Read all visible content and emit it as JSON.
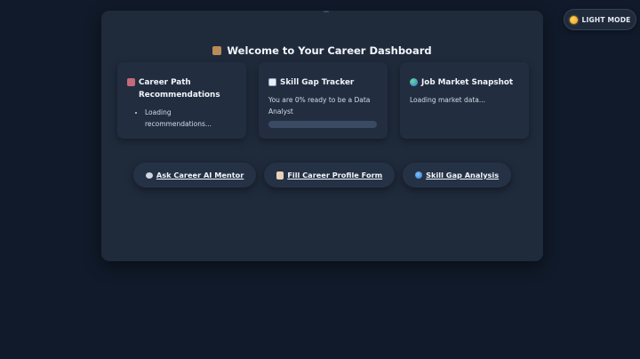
{
  "theme_toggle": {
    "label": "LIGHT MODE",
    "icon": "sun-icon"
  },
  "dashboard": {
    "title": "Welcome to Your Career Dashboard",
    "title_icon": "trophy-icon"
  },
  "cards": {
    "career_path": {
      "title": "Career Path Recommendations",
      "icon": "mentor-icon",
      "items": [
        "Loading recommendations..."
      ]
    },
    "skill_gap": {
      "title": "Skill Gap Tracker",
      "icon": "chart-icon",
      "text": "You are 0% ready to be a Data Analyst",
      "progress": 0,
      "accent": "#4a90e2"
    },
    "job_market": {
      "title": "Job Market Snapshot",
      "icon": "globe-icon",
      "text": "Loading market data..."
    }
  },
  "actions": {
    "ask_mentor": {
      "label": "Ask Career AI Mentor",
      "icon": "chat-bubble-icon"
    },
    "fill_profile": {
      "label": "Fill Career Profile Form",
      "icon": "form-icon"
    },
    "skill_gap_analysis": {
      "label": "Skill Gap Analysis",
      "icon": "search-icon"
    }
  },
  "colors": {
    "background": "#111a2a",
    "panel": "#1f2a3b",
    "card": "#222e40",
    "progress_track": "#3a4a62"
  }
}
